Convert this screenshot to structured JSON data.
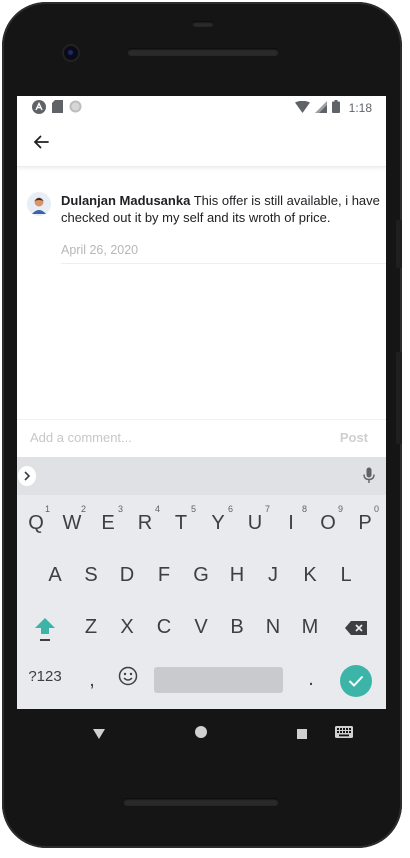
{
  "status_bar": {
    "time": "1:18"
  },
  "comment": {
    "author": "Dulanjan Madusanka",
    "text": "This offer is still available, i have checked out it by my self and its wroth of price.",
    "date": "April 26, 2020"
  },
  "composer": {
    "placeholder": "Add a comment...",
    "post_label": "Post"
  },
  "keyboard": {
    "row1": [
      "Q",
      "W",
      "E",
      "R",
      "T",
      "Y",
      "U",
      "I",
      "O",
      "P"
    ],
    "row1_hints": [
      "1",
      "2",
      "3",
      "4",
      "5",
      "6",
      "7",
      "8",
      "9",
      "0"
    ],
    "row2": [
      "A",
      "S",
      "D",
      "F",
      "G",
      "H",
      "J",
      "K",
      "L"
    ],
    "row3": [
      "Z",
      "X",
      "C",
      "V",
      "B",
      "N",
      "M"
    ],
    "symbols_label": "?123",
    "comma_label": ",",
    "period_label": ".",
    "accent_color": "#3cb5a8"
  }
}
